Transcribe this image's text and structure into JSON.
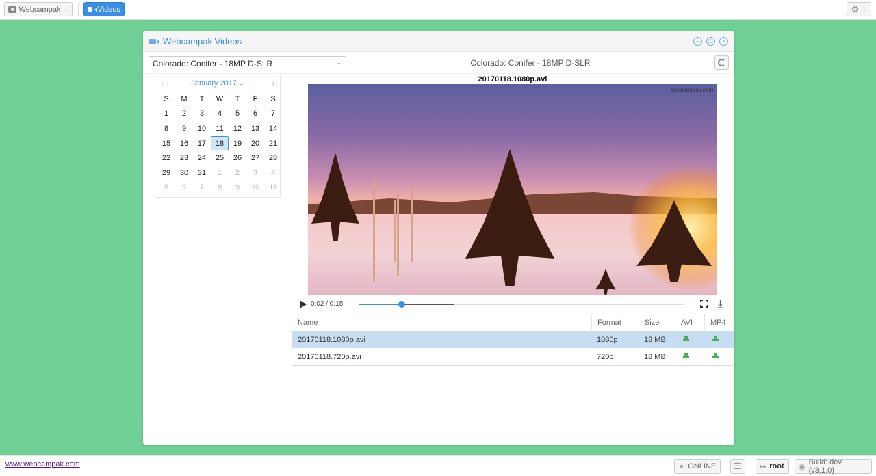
{
  "topbar": {
    "webcampak_label": "Webcampak",
    "videos_label": "Videos"
  },
  "panel": {
    "title": "Webcampak Videos",
    "source_selected": "Colorado: Conifer - 18MP D-SLR",
    "source_label": "Colorado: Conifer - 18MP D-SLR"
  },
  "calendar": {
    "month_label": "January 2017",
    "weekdays": [
      "S",
      "M",
      "T",
      "W",
      "T",
      "F",
      "S"
    ],
    "days": [
      {
        "d": "1",
        "m": false
      },
      {
        "d": "2",
        "m": false
      },
      {
        "d": "3",
        "m": false
      },
      {
        "d": "4",
        "m": false
      },
      {
        "d": "5",
        "m": false
      },
      {
        "d": "6",
        "m": false
      },
      {
        "d": "7",
        "m": false
      },
      {
        "d": "8",
        "m": false
      },
      {
        "d": "9",
        "m": false
      },
      {
        "d": "10",
        "m": false
      },
      {
        "d": "11",
        "m": false
      },
      {
        "d": "12",
        "m": false
      },
      {
        "d": "13",
        "m": false
      },
      {
        "d": "14",
        "m": false
      },
      {
        "d": "15",
        "m": false
      },
      {
        "d": "16",
        "m": false
      },
      {
        "d": "17",
        "m": false
      },
      {
        "d": "18",
        "m": false,
        "selected": true
      },
      {
        "d": "19",
        "m": false
      },
      {
        "d": "20",
        "m": false
      },
      {
        "d": "21",
        "m": false
      },
      {
        "d": "22",
        "m": false
      },
      {
        "d": "23",
        "m": false
      },
      {
        "d": "24",
        "m": false
      },
      {
        "d": "25",
        "m": false
      },
      {
        "d": "26",
        "m": false
      },
      {
        "d": "27",
        "m": false
      },
      {
        "d": "28",
        "m": false
      },
      {
        "d": "29",
        "m": false
      },
      {
        "d": "30",
        "m": false
      },
      {
        "d": "31",
        "m": false
      },
      {
        "d": "1",
        "m": true
      },
      {
        "d": "2",
        "m": true
      },
      {
        "d": "3",
        "m": true
      },
      {
        "d": "4",
        "m": true
      },
      {
        "d": "5",
        "m": true
      },
      {
        "d": "6",
        "m": true
      },
      {
        "d": "7",
        "m": true
      },
      {
        "d": "8",
        "m": true
      },
      {
        "d": "9",
        "m": true
      },
      {
        "d": "10",
        "m": true
      },
      {
        "d": "11",
        "m": true
      }
    ]
  },
  "player": {
    "video_title": "20170118.1080p.avi",
    "logo_text": "Webcampak.com",
    "time_text": "0:02 / 0:15",
    "progress_fraction": 0.133,
    "buffered_fraction": 0.295
  },
  "files": {
    "headers": {
      "name": "Name",
      "format": "Format",
      "size": "Size",
      "avi": "AVI",
      "mp4": "MP4"
    },
    "rows": [
      {
        "name": "20170118.1080p.avi",
        "format": "1080p",
        "size": "18 MB",
        "active": true
      },
      {
        "name": "20170118.720p.avi",
        "format": "720p",
        "size": "18 MB",
        "active": false
      }
    ]
  },
  "footer": {
    "link": "www.webcampak.com",
    "online": "ONLINE",
    "user": "root",
    "build": "Build: dev (v3.1.0)"
  },
  "colors": {
    "background": "#6fcf94",
    "accent": "#3a8ee6",
    "selected_row": "#c6ddf2",
    "download_green": "#4caf50"
  }
}
